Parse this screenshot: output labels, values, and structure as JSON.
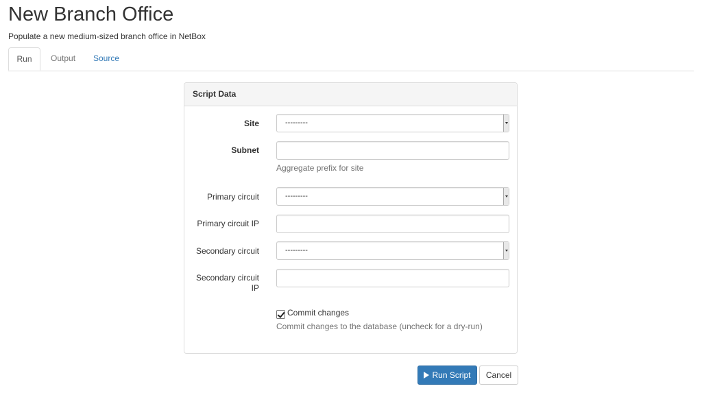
{
  "header": {
    "title": "New Branch Office",
    "subtitle": "Populate a new medium-sized branch office in NetBox"
  },
  "tabs": [
    {
      "label": "Run",
      "active": true
    },
    {
      "label": "Output",
      "active": false
    },
    {
      "label": "Source",
      "active": false
    }
  ],
  "panel": {
    "heading": "Script Data",
    "fields": {
      "site": {
        "label": "Site",
        "value": "---------"
      },
      "subnet": {
        "label": "Subnet",
        "value": "",
        "help": "Aggregate prefix for site"
      },
      "primary_circuit": {
        "label": "Primary circuit",
        "value": "---------"
      },
      "primary_circuit_ip": {
        "label": "Primary circuit IP",
        "value": ""
      },
      "secondary_circuit": {
        "label": "Secondary circuit",
        "value": "---------"
      },
      "secondary_circuit_ip": {
        "label": "Secondary circuit IP",
        "value": ""
      },
      "commit": {
        "label": "Commit changes",
        "checked": true,
        "help": "Commit changes to the database (uncheck for a dry-run)"
      }
    }
  },
  "actions": {
    "run_label": "Run Script",
    "cancel_label": "Cancel"
  },
  "colors": {
    "primary": "#337ab7",
    "link": "#337ab7",
    "muted": "#737373"
  }
}
